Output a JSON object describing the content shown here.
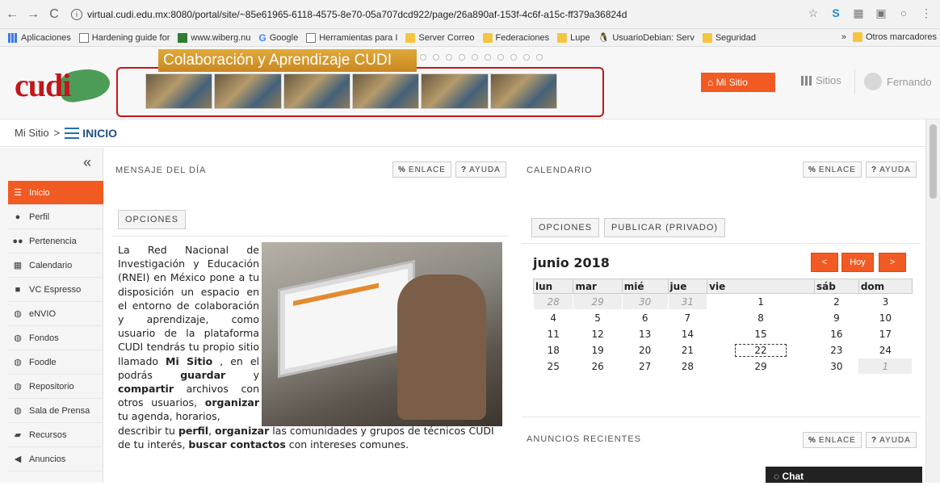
{
  "browser": {
    "url": "virtual.cudi.edu.mx:8080/portal/site/~85e61965-6118-4575-8e70-05a707dcd922/page/26a890af-153f-4c6f-a15c-ff379a36824d",
    "bookmarks": [
      {
        "label": "Aplicaciones",
        "icon": "apps-icon"
      },
      {
        "label": "Hardening guide for",
        "icon": "page-icon"
      },
      {
        "label": "www.wiberg.nu",
        "icon": "site-icon"
      },
      {
        "label": "Google",
        "icon": "google-icon"
      },
      {
        "label": "Herramientas para I",
        "icon": "page-icon"
      },
      {
        "label": "Server Correo",
        "icon": "folder-icon"
      },
      {
        "label": "Federaciones",
        "icon": "folder-icon"
      },
      {
        "label": "Lupe",
        "icon": "folder-icon"
      },
      {
        "label": "UsuarioDebian: Serv",
        "icon": "linux-icon"
      },
      {
        "label": "Seguridad",
        "icon": "folder-icon"
      }
    ],
    "more": "»",
    "other_bookmarks": "Otros marcadores"
  },
  "header": {
    "logo_text": "cudi",
    "banner_title": "Colaboración y Aprendizaje CUDI",
    "my_site_button": "Mi Sitio",
    "sites_label": "Sitios",
    "user_name": "Fernando"
  },
  "breadcrumb": {
    "parent": "Mi Sitio",
    "separator": ">",
    "current": "INICIO"
  },
  "sidebar": {
    "collapse": "«",
    "items": [
      {
        "label": "Inicio",
        "icon": "list-icon",
        "active": true
      },
      {
        "label": "Perfil",
        "icon": "user-icon"
      },
      {
        "label": "Pertenencia",
        "icon": "group-icon"
      },
      {
        "label": "Calendario",
        "icon": "calendar-icon"
      },
      {
        "label": "VC Espresso",
        "icon": "video-icon"
      },
      {
        "label": "eNVIO",
        "icon": "globe-icon"
      },
      {
        "label": "Fondos",
        "icon": "globe-icon"
      },
      {
        "label": "Foodle",
        "icon": "globe-icon"
      },
      {
        "label": "Repositorio",
        "icon": "globe-icon"
      },
      {
        "label": "Sala de Prensa",
        "icon": "globe-icon"
      },
      {
        "label": "Recursos",
        "icon": "folder-open-icon"
      },
      {
        "label": "Anuncios",
        "icon": "megaphone-icon"
      }
    ]
  },
  "message_tool": {
    "title": "MENSAJE DEL DÍA",
    "link_button": "ENLACE",
    "help_button": "AYUDA",
    "options_button": "OPCIONES"
  },
  "calendar_tool": {
    "title": "CALENDARIO",
    "link_button": "ENLACE",
    "help_button": "AYUDA",
    "options_button": "OPCIONES",
    "publish_button": "PUBLICAR (PRIVADO)",
    "month_title": "junio 2018",
    "prev": "<",
    "today": "Hoy",
    "next": ">",
    "weekdays": [
      "lun",
      "mar",
      "mié",
      "jue",
      "vie",
      "sáb",
      "dom"
    ],
    "weeks": [
      [
        "28",
        "29",
        "30",
        "31",
        "1",
        "2",
        "3"
      ],
      [
        "4",
        "5",
        "6",
        "7",
        "8",
        "9",
        "10"
      ],
      [
        "11",
        "12",
        "13",
        "14",
        "15",
        "16",
        "17"
      ],
      [
        "18",
        "19",
        "20",
        "21",
        "22",
        "23",
        "24"
      ],
      [
        "25",
        "26",
        "27",
        "28",
        "29",
        "30",
        "1"
      ]
    ]
  },
  "announcements_tool": {
    "title": "ANUNCIOS RECIENTES",
    "link_button": "ENLACE",
    "help_button": "AYUDA"
  },
  "chat": {
    "label": "Chat"
  }
}
